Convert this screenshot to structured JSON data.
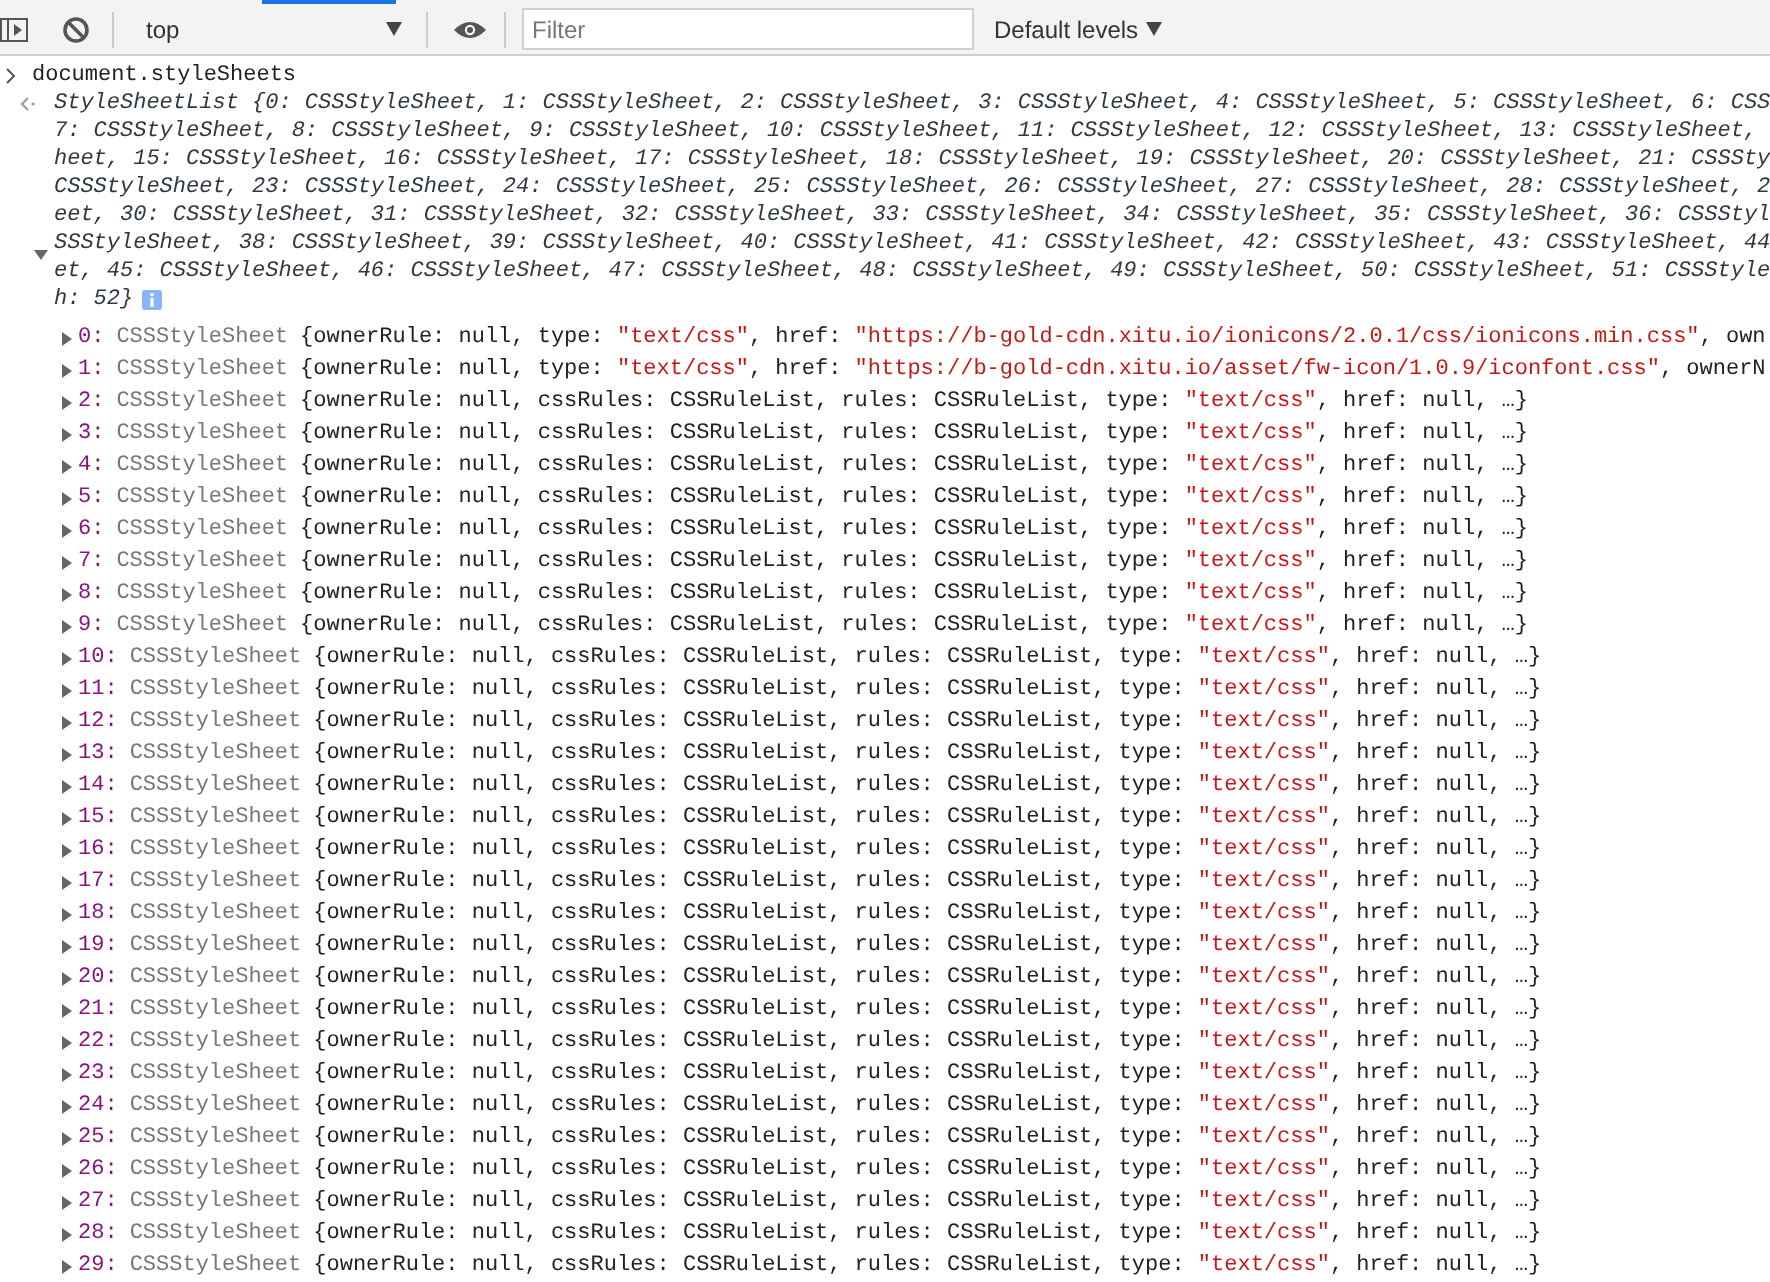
{
  "toolbar": {
    "context": "top",
    "filter": {
      "placeholder": "Filter"
    },
    "levels": "Default levels"
  },
  "console": {
    "input": "document.styleSheets",
    "result": {
      "expanded": true,
      "summary_lines": [
        "StyleSheetList {0: CSSStyleSheet, 1: CSSStyleSheet, 2: CSSStyleSheet, 3: CSSStyleSheet, 4: CSSStyleSheet, 5: CSSStyleSheet, 6: CSS",
        "7: CSSStyleSheet, 8: CSSStyleSheet, 9: CSSStyleSheet, 10: CSSStyleSheet, 11: CSSStyleSheet, 12: CSSStyleSheet, 13: CSSStyleSheet,",
        "heet, 15: CSSStyleSheet, 16: CSSStyleSheet, 17: CSSStyleSheet, 18: CSSStyleSheet, 19: CSSStyleSheet, 20: CSSStyleSheet, 21: CSSSty",
        "CSSStyleSheet, 23: CSSStyleSheet, 24: CSSStyleSheet, 25: CSSStyleSheet, 26: CSSStyleSheet, 27: CSSStyleSheet, 28: CSSStyleSheet, 2",
        "eet, 30: CSSStyleSheet, 31: CSSStyleSheet, 32: CSSStyleSheet, 33: CSSStyleSheet, 34: CSSStyleSheet, 35: CSSStyleSheet, 36: CSSStyl",
        "SSStyleSheet, 38: CSSStyleSheet, 39: CSSStyleSheet, 40: CSSStyleSheet, 41: CSSStyleSheet, 42: CSSStyleSheet, 43: CSSStyleSheet, 44",
        "et, 45: CSSStyleSheet, 46: CSSStyleSheet, 47: CSSStyleSheet, 48: CSSStyleSheet, 49: CSSStyleSheet, 50: CSSStyleSheet, 51: CSSStyle",
        "h: 52}"
      ],
      "properties": [
        {
          "index": "0:",
          "type": "CSSStyleSheet",
          "preview": "{ownerRule: null, type: \"text/css\", href: \"https://b-gold-cdn.xitu.io/ionicons/2.0.1/css/ionicons.min.css\", own",
          "expanded": false
        },
        {
          "index": "1:",
          "type": "CSSStyleSheet",
          "preview": "{ownerRule: null, type: \"text/css\", href: \"https://b-gold-cdn.xitu.io/asset/fw-icon/1.0.9/iconfont.css\", ownerN",
          "expanded": false
        },
        {
          "index": "2:",
          "type": "CSSStyleSheet",
          "preview": "{ownerRule: null, cssRules: CSSRuleList, rules: CSSRuleList, type: \"text/css\", href: null, …}",
          "expanded": false
        },
        {
          "index": "3:",
          "type": "CSSStyleSheet",
          "preview": "{ownerRule: null, cssRules: CSSRuleList, rules: CSSRuleList, type: \"text/css\", href: null, …}",
          "expanded": false
        },
        {
          "index": "4:",
          "type": "CSSStyleSheet",
          "preview": "{ownerRule: null, cssRules: CSSRuleList, rules: CSSRuleList, type: \"text/css\", href: null, …}",
          "expanded": false
        },
        {
          "index": "5:",
          "type": "CSSStyleSheet",
          "preview": "{ownerRule: null, cssRules: CSSRuleList, rules: CSSRuleList, type: \"text/css\", href: null, …}",
          "expanded": false
        },
        {
          "index": "6:",
          "type": "CSSStyleSheet",
          "preview": "{ownerRule: null, cssRules: CSSRuleList, rules: CSSRuleList, type: \"text/css\", href: null, …}",
          "expanded": false
        },
        {
          "index": "7:",
          "type": "CSSStyleSheet",
          "preview": "{ownerRule: null, cssRules: CSSRuleList, rules: CSSRuleList, type: \"text/css\", href: null, …}",
          "expanded": false
        },
        {
          "index": "8:",
          "type": "CSSStyleSheet",
          "preview": "{ownerRule: null, cssRules: CSSRuleList, rules: CSSRuleList, type: \"text/css\", href: null, …}",
          "expanded": false
        },
        {
          "index": "9:",
          "type": "CSSStyleSheet",
          "preview": "{ownerRule: null, cssRules: CSSRuleList, rules: CSSRuleList, type: \"text/css\", href: null, …}",
          "expanded": false
        },
        {
          "index": "10:",
          "type": "CSSStyleSheet",
          "preview": "{ownerRule: null, cssRules: CSSRuleList, rules: CSSRuleList, type: \"text/css\", href: null, …}",
          "expanded": false
        },
        {
          "index": "11:",
          "type": "CSSStyleSheet",
          "preview": "{ownerRule: null, cssRules: CSSRuleList, rules: CSSRuleList, type: \"text/css\", href: null, …}",
          "expanded": false
        },
        {
          "index": "12:",
          "type": "CSSStyleSheet",
          "preview": "{ownerRule: null, cssRules: CSSRuleList, rules: CSSRuleList, type: \"text/css\", href: null, …}",
          "expanded": false
        },
        {
          "index": "13:",
          "type": "CSSStyleSheet",
          "preview": "{ownerRule: null, cssRules: CSSRuleList, rules: CSSRuleList, type: \"text/css\", href: null, …}",
          "expanded": false
        },
        {
          "index": "14:",
          "type": "CSSStyleSheet",
          "preview": "{ownerRule: null, cssRules: CSSRuleList, rules: CSSRuleList, type: \"text/css\", href: null, …}",
          "expanded": false
        },
        {
          "index": "15:",
          "type": "CSSStyleSheet",
          "preview": "{ownerRule: null, cssRules: CSSRuleList, rules: CSSRuleList, type: \"text/css\", href: null, …}",
          "expanded": false
        },
        {
          "index": "16:",
          "type": "CSSStyleSheet",
          "preview": "{ownerRule: null, cssRules: CSSRuleList, rules: CSSRuleList, type: \"text/css\", href: null, …}",
          "expanded": false
        },
        {
          "index": "17:",
          "type": "CSSStyleSheet",
          "preview": "{ownerRule: null, cssRules: CSSRuleList, rules: CSSRuleList, type: \"text/css\", href: null, …}",
          "expanded": false
        },
        {
          "index": "18:",
          "type": "CSSStyleSheet",
          "preview": "{ownerRule: null, cssRules: CSSRuleList, rules: CSSRuleList, type: \"text/css\", href: null, …}",
          "expanded": false
        },
        {
          "index": "19:",
          "type": "CSSStyleSheet",
          "preview": "{ownerRule: null, cssRules: CSSRuleList, rules: CSSRuleList, type: \"text/css\", href: null, …}",
          "expanded": false
        },
        {
          "index": "20:",
          "type": "CSSStyleSheet",
          "preview": "{ownerRule: null, cssRules: CSSRuleList, rules: CSSRuleList, type: \"text/css\", href: null, …}",
          "expanded": false
        },
        {
          "index": "21:",
          "type": "CSSStyleSheet",
          "preview": "{ownerRule: null, cssRules: CSSRuleList, rules: CSSRuleList, type: \"text/css\", href: null, …}",
          "expanded": false
        },
        {
          "index": "22:",
          "type": "CSSStyleSheet",
          "preview": "{ownerRule: null, cssRules: CSSRuleList, rules: CSSRuleList, type: \"text/css\", href: null, …}",
          "expanded": false
        },
        {
          "index": "23:",
          "type": "CSSStyleSheet",
          "preview": "{ownerRule: null, cssRules: CSSRuleList, rules: CSSRuleList, type: \"text/css\", href: null, …}",
          "expanded": false
        },
        {
          "index": "24:",
          "type": "CSSStyleSheet",
          "preview": "{ownerRule: null, cssRules: CSSRuleList, rules: CSSRuleList, type: \"text/css\", href: null, …}",
          "expanded": false
        },
        {
          "index": "25:",
          "type": "CSSStyleSheet",
          "preview": "{ownerRule: null, cssRules: CSSRuleList, rules: CSSRuleList, type: \"text/css\", href: null, …}",
          "expanded": false
        },
        {
          "index": "26:",
          "type": "CSSStyleSheet",
          "preview": "{ownerRule: null, cssRules: CSSRuleList, rules: CSSRuleList, type: \"text/css\", href: null, …}",
          "expanded": false
        },
        {
          "index": "27:",
          "type": "CSSStyleSheet",
          "preview": "{ownerRule: null, cssRules: CSSRuleList, rules: CSSRuleList, type: \"text/css\", href: null, …}",
          "expanded": false
        },
        {
          "index": "28:",
          "type": "CSSStyleSheet",
          "preview": "{ownerRule: null, cssRules: CSSRuleList, rules: CSSRuleList, type: \"text/css\", href: null, …}",
          "expanded": false
        },
        {
          "index": "29:",
          "type": "CSSStyleSheet",
          "preview": "{ownerRule: null, cssRules: CSSRuleList, rules: CSSRuleList, type: \"text/css\", href: null, …}",
          "expanded": false
        }
      ]
    }
  }
}
